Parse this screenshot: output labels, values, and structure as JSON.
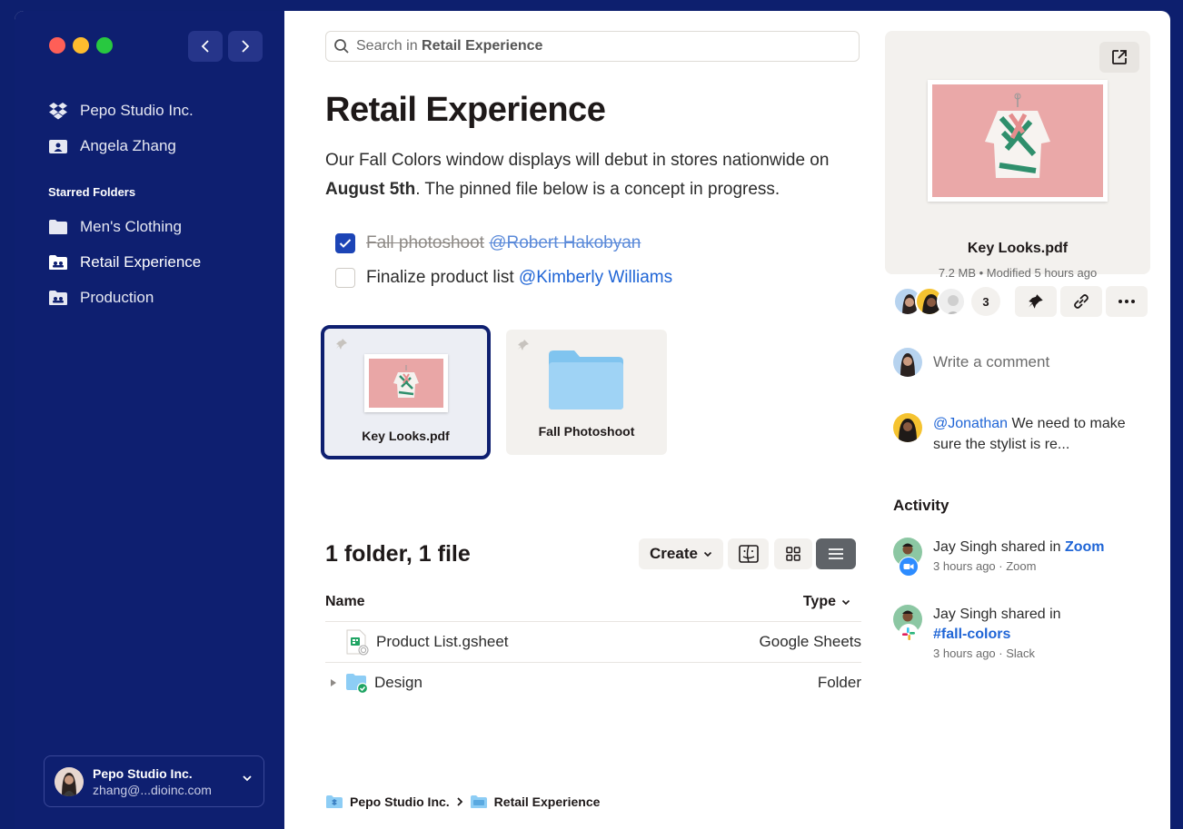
{
  "sidebar": {
    "team": "Pepo Studio Inc.",
    "user": "Angela Zhang",
    "starred_heading": "Starred Folders",
    "folders": [
      "Men's Clothing",
      "Retail Experience",
      "Production"
    ],
    "account": {
      "name": "Pepo Studio Inc.",
      "email": "zhang@...dioinc.com"
    }
  },
  "search": {
    "prefix": "Search in",
    "scope": "Retail Experience"
  },
  "main": {
    "title": "Retail Experience",
    "desc_pre": "Our Fall Colors window displays will debut in stores nationwide on ",
    "desc_bold": "August 5th",
    "desc_post": ". The pinned file below is a concept in progress.",
    "tasks": [
      {
        "text": "Fall photoshoot",
        "mention": "@Robert Hakobyan",
        "done": true
      },
      {
        "text": "Finalize product list",
        "mention": "@Kimberly Williams",
        "done": false
      }
    ],
    "pinned": [
      "Key Looks.pdf",
      "Fall Photoshoot"
    ],
    "count_title": "1 folder, 1 file",
    "create_label": "Create",
    "col_name": "Name",
    "col_type": "Type",
    "rows": [
      {
        "name": "Product List.gsheet",
        "type": "Google Sheets"
      },
      {
        "name": "Design",
        "type": "Folder"
      }
    ],
    "breadcrumb": [
      "Pepo Studio Inc.",
      "Retail Experience"
    ]
  },
  "panel": {
    "file_name": "Key Looks.pdf",
    "file_meta": "7.2 MB • Modified 5 hours ago",
    "viewer_count": "3",
    "comment_placeholder": "Write a comment",
    "comment_mention": "@Jonathan",
    "comment_text": " We need to make sure the stylist is re...",
    "activity_heading": "Activity",
    "activity": [
      {
        "text": "Jay Singh shared in ",
        "link": "Zoom",
        "sub": "3 hours ago · Zoom"
      },
      {
        "text": "Jay Singh shared in",
        "link": "#fall-colors",
        "sub": "3 hours ago · Slack"
      }
    ]
  },
  "colors": {
    "sidebar": "#0e1f70",
    "accent": "#1c44b6",
    "link": "#1f65d6"
  }
}
